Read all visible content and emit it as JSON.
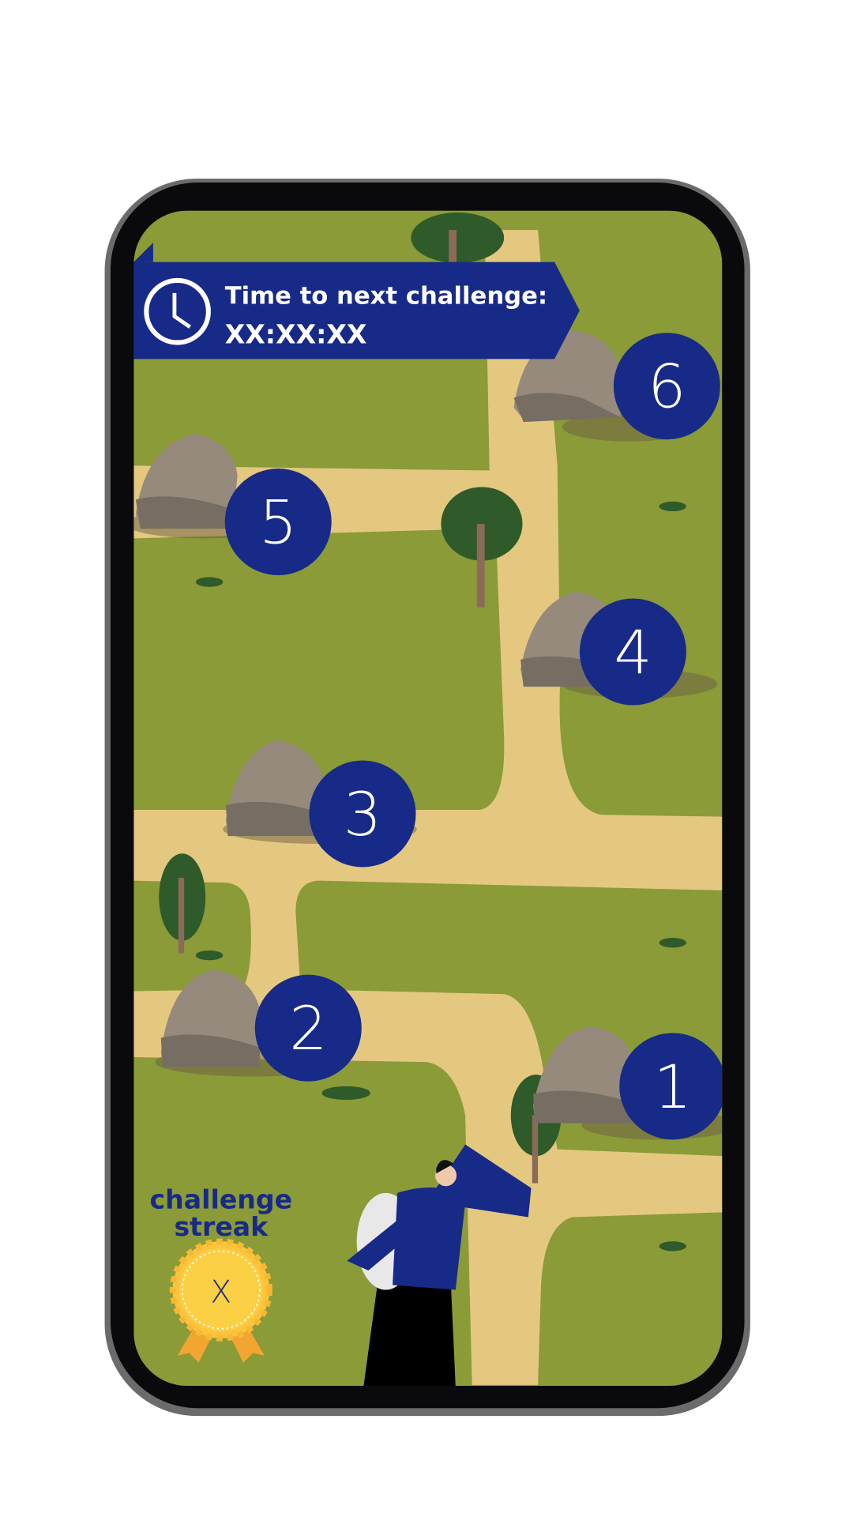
{
  "banner": {
    "title": "Time to next challenge:",
    "countdown": "XX:XX:XX",
    "icon": "clock-icon"
  },
  "levels": [
    {
      "label": "1"
    },
    {
      "label": "2"
    },
    {
      "label": "3"
    },
    {
      "label": "4"
    },
    {
      "label": "5"
    },
    {
      "label": "6"
    }
  ],
  "streak": {
    "line1": "challenge",
    "line2": "streak",
    "value": "X",
    "icon": "medal-icon"
  },
  "colors": {
    "primary": "#172a87",
    "grass": "#8a9b38",
    "path": "#e5c880",
    "medal": "#fcd045"
  }
}
